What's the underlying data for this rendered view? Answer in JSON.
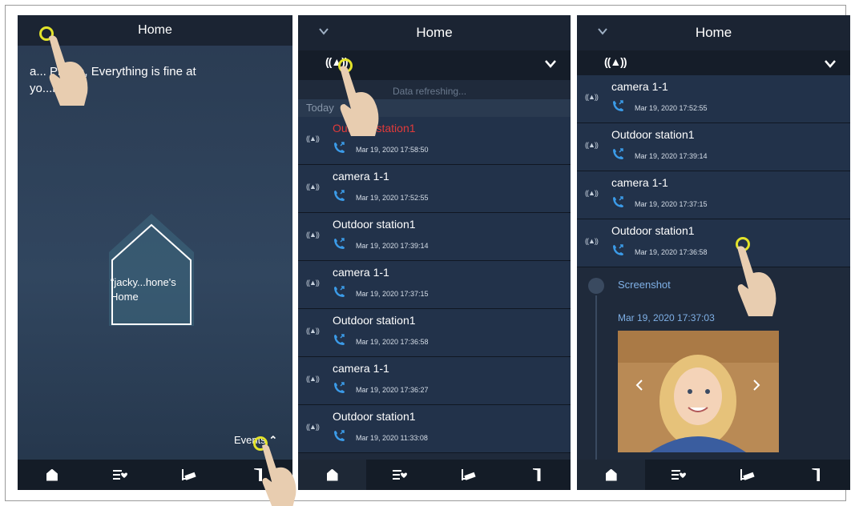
{
  "panel1": {
    "title": "Home",
    "greeting": "...Phone, Everything is fine at your home!",
    "greeting_line1": "a... Phone, Everything is fine at",
    "greeting_line2": "yo...me!",
    "house_label": "“jacky...hone's Home",
    "events_label": "Events",
    "tabs": [
      "home-icon",
      "event-list-icon",
      "camera-icon",
      "door-icon"
    ]
  },
  "panel2": {
    "title": "Home",
    "loading_text": "Data refreshing...",
    "section": "Today",
    "rows": [
      {
        "name": "Outdoor station1",
        "date": "Mar 19, 2020 17:58:50",
        "missed": true
      },
      {
        "name": "camera 1-1",
        "date": "Mar 19, 2020 17:52:55",
        "missed": false
      },
      {
        "name": "Outdoor station1",
        "date": "Mar 19, 2020 17:39:14",
        "missed": false
      },
      {
        "name": "camera 1-1",
        "date": "Mar 19, 2020 17:37:15",
        "missed": false
      },
      {
        "name": "Outdoor station1",
        "date": "Mar 19, 2020 17:36:58",
        "missed": false
      },
      {
        "name": "camera 1-1",
        "date": "Mar 19, 2020 17:36:27",
        "missed": false
      },
      {
        "name": "Outdoor station1",
        "date": "Mar 19, 2020 11:33:08",
        "missed": false
      }
    ]
  },
  "panel3": {
    "title": "Home",
    "rows": [
      {
        "name": "camera 1-1",
        "date": "Mar 19, 2020 17:52:55"
      },
      {
        "name": "Outdoor station1",
        "date": "Mar 19, 2020 17:39:14"
      },
      {
        "name": "camera 1-1",
        "date": "Mar 19, 2020 17:37:15"
      },
      {
        "name": "Outdoor station1",
        "date": "Mar 19, 2020 17:36:58"
      }
    ],
    "screenshot_title": "Screenshot",
    "screenshot_date": "Mar 19, 2020 17:37:03"
  },
  "ring_symbol": "((▲))",
  "colors": {
    "accent": "#3b9be8",
    "missed": "#e23a3a",
    "highlight": "#e3e32a"
  }
}
